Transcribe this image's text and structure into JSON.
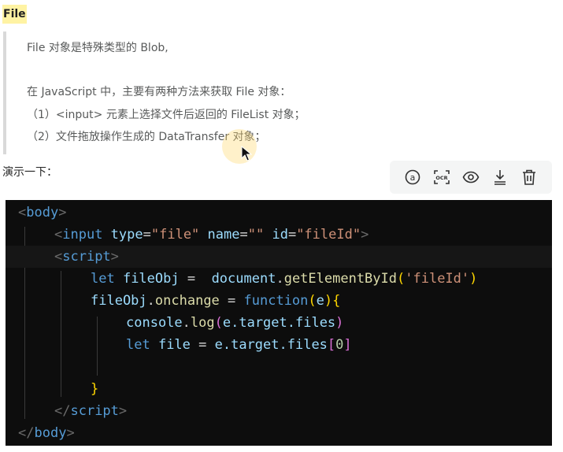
{
  "heading": "File",
  "quote": {
    "line1": "File 对象是特殊类型的 Blob,",
    "line2": "在 JavaScript 中，主要有两种方法来获取 File 对象：",
    "line3": "（1）<input> 元素上选择文件后返回的 FileList 对象；",
    "line4": "（2）文件拖放操作生成的 DataTransfer 对象；"
  },
  "demo_label": "演示一下：",
  "toolbar": {
    "icons": [
      "mention-icon",
      "ocr-icon",
      "eye-icon",
      "download-icon",
      "trash-icon"
    ]
  },
  "code": {
    "l1": {
      "open": "<",
      "tag": "body",
      "close": ">"
    },
    "l2": {
      "open": "<",
      "tag": "input",
      "attr1": " type",
      "eq1": "=",
      "val1": "\"file\"",
      "attr2": " name",
      "eq2": "=",
      "val2": "\"\"",
      "attr3": " id",
      "eq3": "=",
      "val3": "\"fileId\"",
      "close": ">"
    },
    "l3": {
      "open": "<",
      "tag": "script",
      "close": ">"
    },
    "l4": {
      "kw": "let",
      "var": " fileObj",
      "op": " =  ",
      "obj": "document",
      "dot": ".",
      "fn": "getElementById",
      "p1": "(",
      "arg": "'fileId'",
      "p2": ")"
    },
    "l5": {
      "var": "fileObj",
      "dot": ".",
      "prop": "onchange",
      "op": " = ",
      "kw": "function",
      "p1": "(",
      "arg": "e",
      "p2": ")",
      "brace": "{"
    },
    "l6": {
      "obj": "console",
      "dot": ".",
      "fn": "log",
      "p1": "(",
      "arg": "e.target.files",
      "p2": ")"
    },
    "l7": {
      "kw": "let",
      "var": " file",
      "op": " = ",
      "val": "e.target.files",
      "b1": "[",
      "num": "0",
      "b2": "]"
    },
    "l9": {
      "brace": "}"
    },
    "l10": {
      "open": "</",
      "tag": "script",
      "close": ">"
    },
    "l11": {
      "open": "</",
      "tag": "body",
      "close": ">"
    }
  }
}
